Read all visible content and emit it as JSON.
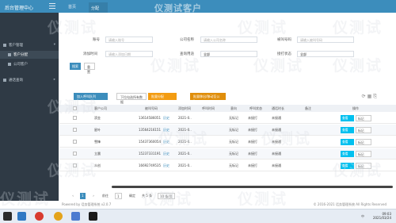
{
  "header": {
    "brand": "后台管理中心",
    "home": "首页",
    "tab": "分配",
    "title": "仪测试客户"
  },
  "sidebar": {
    "items": [
      {
        "label": "客户管理",
        "type": "group"
      },
      {
        "label": "客户分配",
        "type": "sub",
        "active": true
      },
      {
        "label": "公司客户",
        "type": "sub"
      },
      {
        "label": "通话查询",
        "type": "group"
      }
    ]
  },
  "filters": {
    "row1": [
      {
        "label": "账号",
        "placeholder": "请输入账号"
      },
      {
        "label": "公司名称",
        "placeholder": "请输入公司名称"
      },
      {
        "label": "被叫号码",
        "placeholder": "请输入被叫号码"
      }
    ],
    "row2": [
      {
        "label": "添加时间",
        "placeholder": "请输入添加日期"
      },
      {
        "label": "查询用途",
        "value": "全部"
      },
      {
        "label": "接打状态",
        "value": "全部"
      }
    ],
    "search": "搜索",
    "reset": "重置"
  },
  "toolbar": {
    "btn1": "加入呼叫队列",
    "btn2": "下拉勾选所有数据",
    "btn3": "批量分配",
    "btn4": "批量移出/移动至公海"
  },
  "table": {
    "headers": [
      "客户公司",
      "被叫号码",
      "添加时间",
      "呼叫时间",
      "意向",
      "呼叫状态",
      "通话时长",
      "备注",
      "操作"
    ],
    "rows": [
      {
        "company": "滨金",
        "phone": "13614586051",
        "tag": "历史",
        "time": "2021-0..",
        "intent": "无标记",
        "status": "未接打",
        "dur": "未接通"
      },
      {
        "company": "星叶",
        "phone": "13564216151",
        "tag": "历史",
        "time": "2021-0..",
        "intent": "无标记",
        "status": "未接打",
        "dur": "未接通"
      },
      {
        "company": "雪锋",
        "phone": "15437360054",
        "tag": "历史",
        "time": "2021-0..",
        "intent": "无标记",
        "status": "未接打",
        "dur": "未接通"
      },
      {
        "company": "立晨",
        "phone": "15237331191",
        "tag": "历史",
        "time": "2021-0..",
        "intent": "无标记",
        "status": "未接打",
        "dur": "未接通"
      },
      {
        "company": "众创",
        "phone": "16692749535",
        "tag": "历史",
        "time": "2021-0..",
        "intent": "无标记",
        "status": "未接打",
        "dur": "未接通"
      }
    ],
    "edit": "查看",
    "mark": "标记"
  },
  "pager": {
    "current": "1",
    "goto": "前往",
    "page": "1",
    "confirm": "确定",
    "total": "共 5 条",
    "size": "10 条/页"
  },
  "footer": {
    "left": "Powered by 话务管理系统 v2.0.7",
    "right": "© 2016-2021 话务管理系统 All Rights Reserved"
  },
  "taskbar": {
    "time": "09:03",
    "date": "2021/03/24",
    "lang": "中"
  },
  "watermark": "仪测试"
}
